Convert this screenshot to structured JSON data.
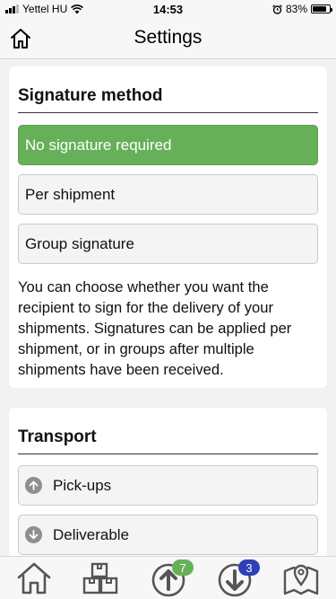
{
  "status_bar": {
    "carrier": "Yettel HU",
    "time": "14:53",
    "battery": "83%",
    "battery_level": 0.83
  },
  "header": {
    "title": "Settings",
    "home_icon": "home-icon"
  },
  "signature": {
    "title": "Signature method",
    "options": [
      {
        "label": "No signature required",
        "selected": true
      },
      {
        "label": "Per shipment",
        "selected": false
      },
      {
        "label": "Group signature",
        "selected": false
      }
    ],
    "description": "You can choose whether you want the recipient to sign for the delivery of your shipments. Signatures can be applied per shipment, or in groups after multiple shipments have been received."
  },
  "transport": {
    "title": "Transport",
    "items": [
      {
        "label": "Pick-ups",
        "icon": "arrow-up-circle-icon"
      },
      {
        "label": "Deliverable",
        "icon": "arrow-down-circle-icon"
      }
    ]
  },
  "tab_bar": {
    "tabs": [
      {
        "name": "home",
        "icon": "home-icon"
      },
      {
        "name": "packages",
        "icon": "boxes-icon"
      },
      {
        "name": "pickups",
        "icon": "upload-circle-icon",
        "badge": "7"
      },
      {
        "name": "deliveries",
        "icon": "download-circle-icon",
        "badge": "3"
      },
      {
        "name": "map",
        "icon": "map-pin-icon"
      }
    ]
  },
  "colors": {
    "selected_green": "#66b05a",
    "badge_blue": "#2f3fb8",
    "icon_gray": "#8e8e8e"
  }
}
